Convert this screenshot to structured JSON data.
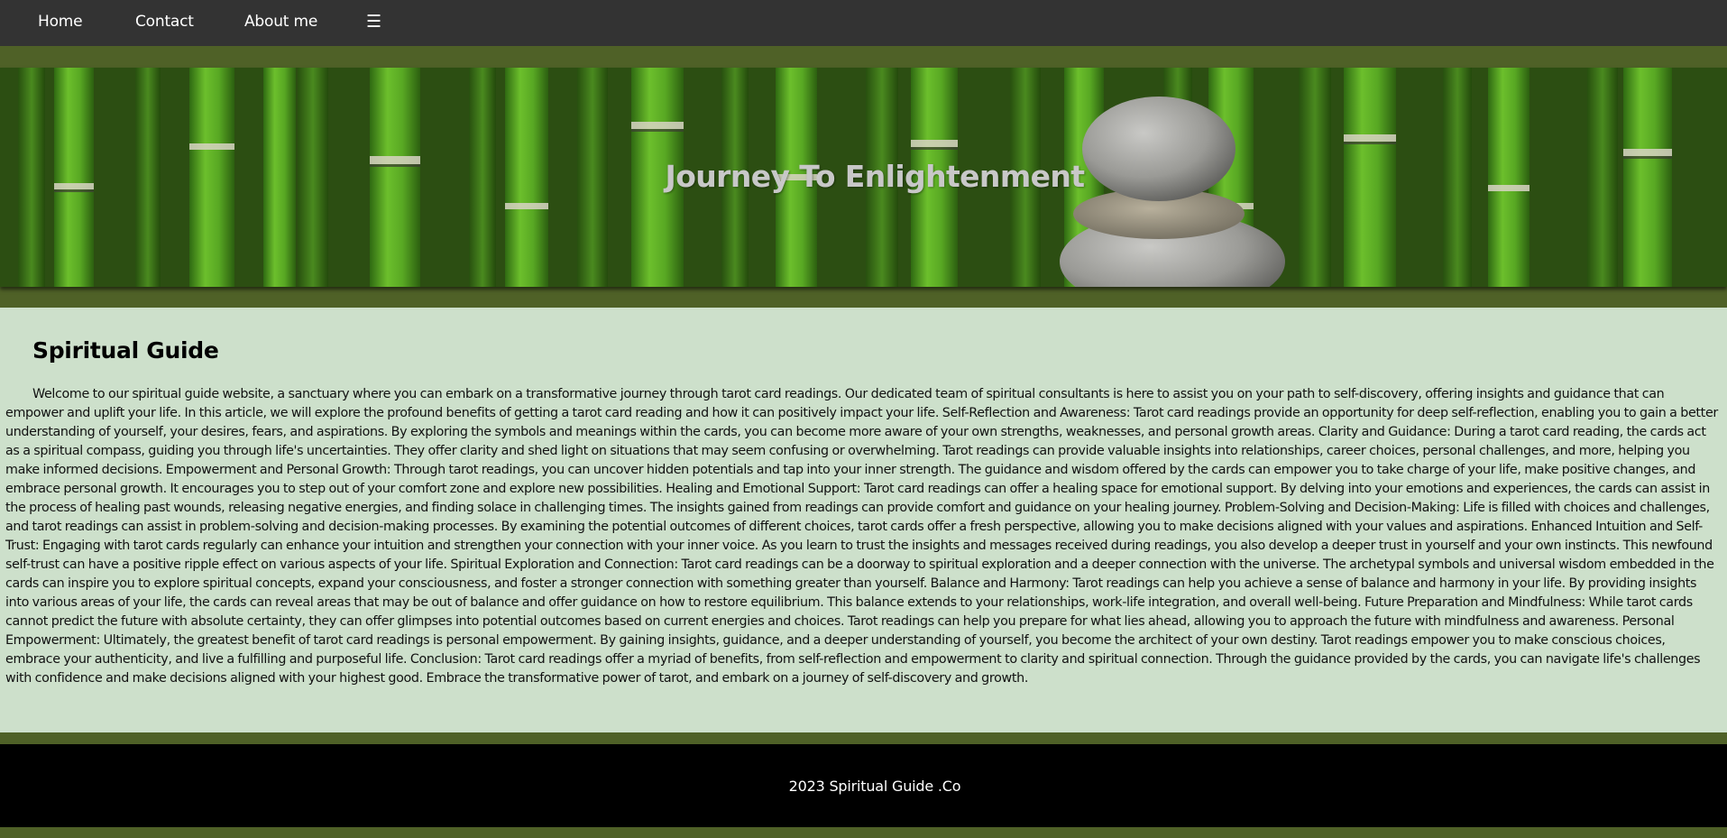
{
  "nav": {
    "items": [
      {
        "label": "Home"
      },
      {
        "label": "Contact"
      },
      {
        "label": "About me"
      }
    ],
    "menu_icon": "☰"
  },
  "hero": {
    "title": "Journey To Enlightenment",
    "image": "bamboo-and-stacked-stones"
  },
  "main": {
    "heading": "Spiritual Guide",
    "body": "Welcome to our spiritual guide website, a sanctuary where you can embark on a transformative journey through tarot card readings. Our dedicated team of spiritual consultants is here to assist you on your path to self-discovery, offering insights and guidance that can empower and uplift your life. In this article, we will explore the profound benefits of getting a tarot card reading and how it can positively impact your life. Self-Reflection and Awareness: Tarot card readings provide an opportunity for deep self-reflection, enabling you to gain a better understanding of yourself, your desires, fears, and aspirations. By exploring the symbols and meanings within the cards, you can become more aware of your own strengths, weaknesses, and personal growth areas. Clarity and Guidance: During a tarot card reading, the cards act as a spiritual compass, guiding you through life's uncertainties. They offer clarity and shed light on situations that may seem confusing or overwhelming. Tarot readings can provide valuable insights into relationships, career choices, personal challenges, and more, helping you make informed decisions. Empowerment and Personal Growth: Through tarot readings, you can uncover hidden potentials and tap into your inner strength. The guidance and wisdom offered by the cards can empower you to take charge of your life, make positive changes, and embrace personal growth. It encourages you to step out of your comfort zone and explore new possibilities. Healing and Emotional Support: Tarot card readings can offer a healing space for emotional support. By delving into your emotions and experiences, the cards can assist in the process of healing past wounds, releasing negative energies, and finding solace in challenging times. The insights gained from readings can provide comfort and guidance on your healing journey. Problem-Solving and Decision-Making: Life is filled with choices and challenges, and tarot readings can assist in problem-solving and decision-making processes. By examining the potential outcomes of different choices, tarot cards offer a fresh perspective, allowing you to make decisions aligned with your values and aspirations. Enhanced Intuition and Self-Trust: Engaging with tarot cards regularly can enhance your intuition and strengthen your connection with your inner voice. As you learn to trust the insights and messages received during readings, you also develop a deeper trust in yourself and your own instincts. This newfound self-trust can have a positive ripple effect on various aspects of your life. Spiritual Exploration and Connection: Tarot card readings can be a doorway to spiritual exploration and a deeper connection with the universe. The archetypal symbols and universal wisdom embedded in the cards can inspire you to explore spiritual concepts, expand your consciousness, and foster a stronger connection with something greater than yourself. Balance and Harmony: Tarot readings can help you achieve a sense of balance and harmony in your life. By providing insights into various areas of your life, the cards can reveal areas that may be out of balance and offer guidance on how to restore equilibrium. This balance extends to your relationships, work-life integration, and overall well-being. Future Preparation and Mindfulness: While tarot cards cannot predict the future with absolute certainty, they can offer glimpses into potential outcomes based on current energies and choices. Tarot readings can help you prepare for what lies ahead, allowing you to approach the future with mindfulness and awareness. Personal Empowerment: Ultimately, the greatest benefit of tarot card readings is personal empowerment. By gaining insights, guidance, and a deeper understanding of yourself, you become the architect of your own destiny. Tarot readings empower you to make conscious choices, embrace your authenticity, and live a fulfilling and purposeful life. Conclusion: Tarot card readings offer a myriad of benefits, from self-reflection and empowerment to clarity and spiritual connection. Through the guidance provided by the cards, you can navigate life's challenges with confidence and make decisions aligned with your highest good. Embrace the transformative power of tarot, and embark on a journey of self-discovery and growth."
  },
  "footer": {
    "text": "2023 Spiritual Guide .Co"
  },
  "colors": {
    "nav_bg": "#333333",
    "page_bg": "#4f6127",
    "content_bg": "#cde0cb",
    "footer_bg": "#000000",
    "hero_title": "#c8c8c8"
  }
}
